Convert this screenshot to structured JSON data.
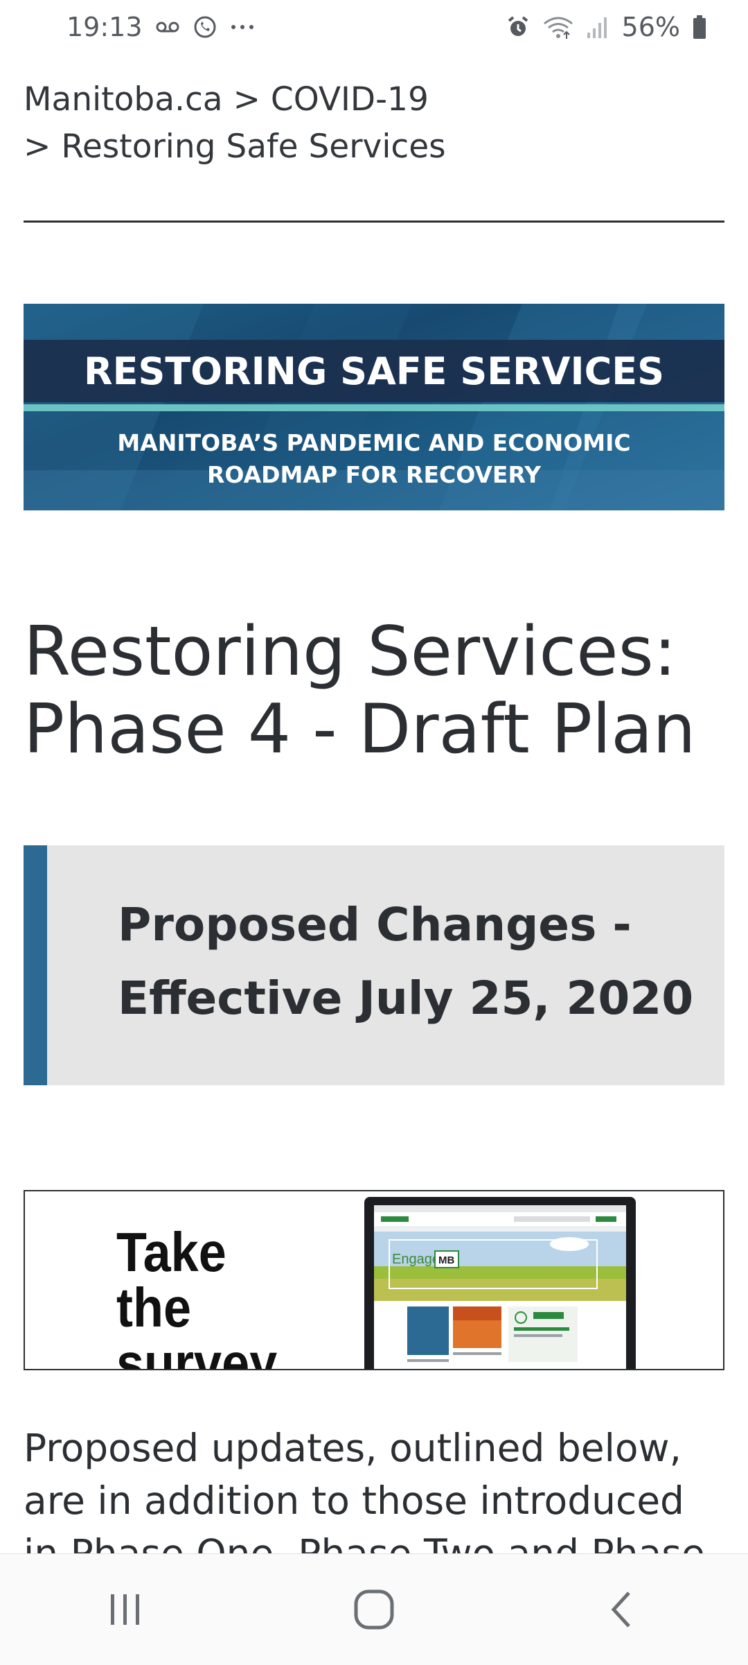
{
  "status_bar": {
    "time": "19:13",
    "battery": "56%",
    "icons": [
      "voicemail-icon",
      "whatsapp-icon",
      "more-icon",
      "alarm-icon",
      "wifi-icon",
      "signal-icon",
      "battery-icon"
    ]
  },
  "breadcrumb": {
    "root": "Manitoba.ca",
    "separator": ">",
    "section": "COVID-19",
    "current": "Restoring Safe Services"
  },
  "banner": {
    "title": "RESTORING SAFE SERVICES",
    "subtitle_line1": "MANITOBA’S PANDEMIC AND ECONOMIC",
    "subtitle_line2": "ROADMAP FOR RECOVERY"
  },
  "page_title": "Restoring Services: Phase 4 - Draft Plan",
  "callout": {
    "line1": "Proposed Changes -",
    "line2": "Effective July 25, 2020"
  },
  "survey": {
    "line1": "Take the",
    "line2": "survey",
    "screen_brand": "Engage",
    "screen_brand_box": "MB"
  },
  "body": {
    "paragraph": "Proposed updates, outlined below, are in addition to those introduced in Phase One, Phase Two and Phase"
  },
  "nav_bar": {
    "icons": [
      "recent-apps-icon",
      "home-icon",
      "back-icon"
    ]
  },
  "colors": {
    "accent": "#2c6a93",
    "banner_dark": "#1b2f4d",
    "banner_teal": "#6cc3c3",
    "callout_bg": "#e4e5e4",
    "text": "#2b2f33"
  }
}
